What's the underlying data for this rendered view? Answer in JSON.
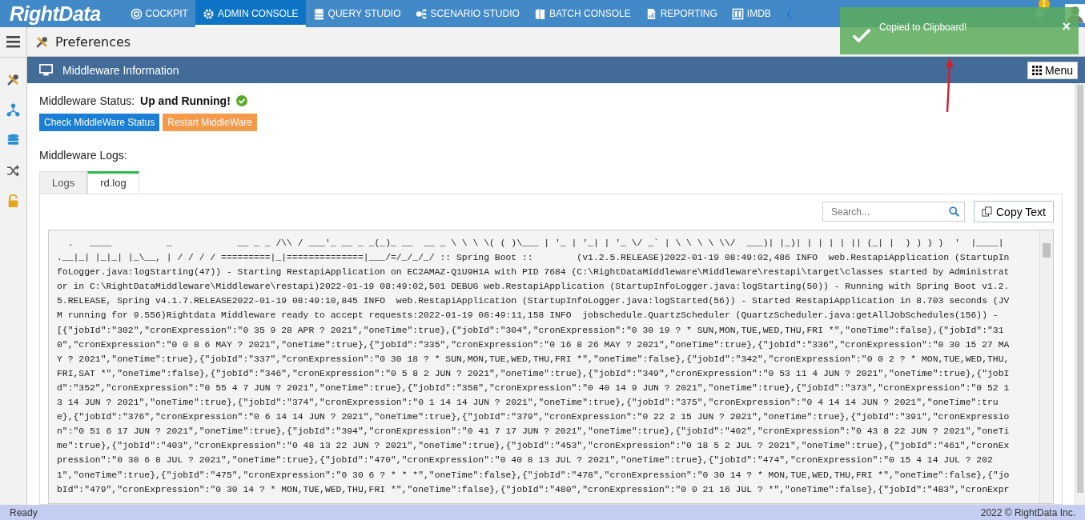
{
  "nav": {
    "logo": "RightData",
    "items": [
      {
        "label": "COCKPIT",
        "selected": false
      },
      {
        "label": "ADMIN CONSOLE",
        "selected": true
      },
      {
        "label": "QUERY STUDIO",
        "selected": false
      },
      {
        "label": "SCENARIO STUDIO",
        "selected": false
      },
      {
        "label": "BATCH CONSOLE",
        "selected": false
      },
      {
        "label": "REPORTING",
        "selected": false
      },
      {
        "label": "IMDB",
        "selected": false
      }
    ],
    "notification_count": "1"
  },
  "toast": {
    "message": "Copied to Clipboard!",
    "close": "×"
  },
  "page_title": "Preferences",
  "panel": {
    "title": "Middleware Information",
    "menu_button": "Menu"
  },
  "status": {
    "label": "Middleware Status:",
    "value": "Up and Running!"
  },
  "buttons": [
    {
      "label": "Check MiddleWare Status",
      "kind": "primary"
    },
    {
      "label": "Restart MiddleWare",
      "kind": "warning"
    }
  ],
  "logs_label": "Middleware Logs:",
  "tabs": [
    {
      "label": "Logs",
      "selected": false
    },
    {
      "label": "rd.log",
      "selected": true
    }
  ],
  "search": {
    "placeholder": "Search..."
  },
  "copy_button": "Copy Text",
  "log_lines": [
    "  .   ____          _            __ _ _ /\\\\ / ___'_ __ _ _(_)_ __  __ _ \\ \\ \\ \\( ( )\\___ | '_ | '_| | '_ \\/ _` | \\ \\ \\ \\ \\\\/  ___)| |_)| | | | | || (_| |  ) ) ) )  '  |____|",
    ".__|_| |_|_| |_\\__, | / / / / =========|_|==============|___/=/_/_/_/ :: Spring Boot ::        (v1.2.5.RELEASE)2022-01-19 08:49:02,486 INFO  web.RestapiApplication (StartupIn",
    "foLogger.java:logStarting(47)) - Starting RestapiApplication on EC2AMAZ-Q1U9H1A with PID 7684 (C:\\RightDataMiddleware\\Middleware\\restapi\\target\\classes started by Administrat",
    "or in C:\\RightDataMiddleware\\Middleware\\restapi)2022-01-19 08:49:02,501 DEBUG web.RestapiApplication (StartupInfoLogger.java:logStarting(50)) - Running with Spring Boot v1.2.",
    "5.RELEASE, Spring v4.1.7.RELEASE2022-01-19 08:49:10,845 INFO  web.RestapiApplication (StartupInfoLogger.java:logStarted(56)) - Started RestapiApplication in 8.703 seconds (JV",
    "M running for 9.556)Rightdata Middleware ready to accept requests:2022-01-19 08:49:11,158 INFO  jobschedule.QuartzScheduler (QuartzScheduler.java:getAllJobSchedules(156)) -",
    "[{\"jobId\":\"302\",\"cronExpression\":\"0 35 9 28 APR ? 2021\",\"oneTime\":true},{\"jobId\":\"304\",\"cronExpression\":\"0 30 19 ? * SUN,MON,TUE,WED,THU,FRI *\",\"oneTime\":false},{\"jobId\":\"31",
    "0\",\"cronExpression\":\"0 0 8 6 MAY ? 2021\",\"oneTime\":true},{\"jobId\":\"335\",\"cronExpression\":\"0 16 8 26 MAY ? 2021\",\"oneTime\":true},{\"jobId\":\"336\",\"cronExpression\":\"0 30 15 27 MA",
    "Y ? 2021\",\"oneTime\":true},{\"jobId\":\"337\",\"cronExpression\":\"0 30 18 ? * SUN,MON,TUE,WED,THU,FRI *\",\"oneTime\":false},{\"jobId\":\"342\",\"cronExpression\":\"0 0 2 ? * MON,TUE,WED,THU,",
    "FRI,SAT *\",\"oneTime\":false},{\"jobId\":\"346\",\"cronExpression\":\"0 5 8 2 JUN ? 2021\",\"oneTime\":true},{\"jobId\":\"349\",\"cronExpression\":\"0 53 11 4 JUN ? 2021\",\"oneTime\":true},{\"jobI",
    "d\":\"352\",\"cronExpression\":\"0 55 4 7 JUN ? 2021\",\"oneTime\":true},{\"jobId\":\"358\",\"cronExpression\":\"0 40 14 9 JUN ? 2021\",\"oneTime\":true},{\"jobId\":\"373\",\"cronExpression\":\"0 52 1",
    "3 14 JUN ? 2021\",\"oneTime\":true},{\"jobId\":\"374\",\"cronExpression\":\"0 1 14 14 JUN ? 2021\",\"oneTime\":true},{\"jobId\":\"375\",\"cronExpression\":\"0 4 14 14 JUN ? 2021\",\"oneTime\":tru",
    "e},{\"jobId\":\"376\",\"cronExpression\":\"0 6 14 14 JUN ? 2021\",\"oneTime\":true},{\"jobId\":\"379\",\"cronExpression\":\"0 22 2 15 JUN ? 2021\",\"oneTime\":true},{\"jobId\":\"391\",\"cronExpressio",
    "n\":\"0 51 6 17 JUN ? 2021\",\"oneTime\":true},{\"jobId\":\"394\",\"cronExpression\":\"0 41 7 17 JUN ? 2021\",\"oneTime\":true},{\"jobId\":\"402\",\"cronExpression\":\"0 43 8 22 JUN ? 2021\",\"oneTi",
    "me\":true},{\"jobId\":\"403\",\"cronExpression\":\"0 48 13 22 JUN ? 2021\",\"oneTime\":true},{\"jobId\":\"453\",\"cronExpression\":\"0 18 5 2 JUL ? 2021\",\"oneTime\":true},{\"jobId\":\"461\",\"cronEx",
    "pression\":\"0 30 6 8 JUL ? 2021\",\"oneTime\":true},{\"jobId\":\"470\",\"cronExpression\":\"0 40 8 13 JUL ? 2021\",\"oneTime\":true},{\"jobId\":\"474\",\"cronExpression\":\"0 15 4 14 JUL ? 202",
    "1\",\"oneTime\":true},{\"jobId\":\"475\",\"cronExpression\":\"0 30 6 ? * * *\",\"oneTime\":false},{\"jobId\":\"478\",\"cronExpression\":\"0 30 14 ? * MON,TUE,WED,THU,FRI *\",\"oneTime\":false},{\"jo",
    "bId\":\"479\",\"cronExpression\":\"0 30 14 ? * MON,TUE,WED,THU,FRI *\",\"oneTime\":false},{\"jobId\":\"480\",\"cronExpression\":\"0 0 21 16 JUL ? *\",\"oneTime\":false},{\"jobId\":\"483\",\"cronExpr"
  ],
  "status_bar": {
    "left": "Ready",
    "right": "2022 © RightData Inc."
  }
}
